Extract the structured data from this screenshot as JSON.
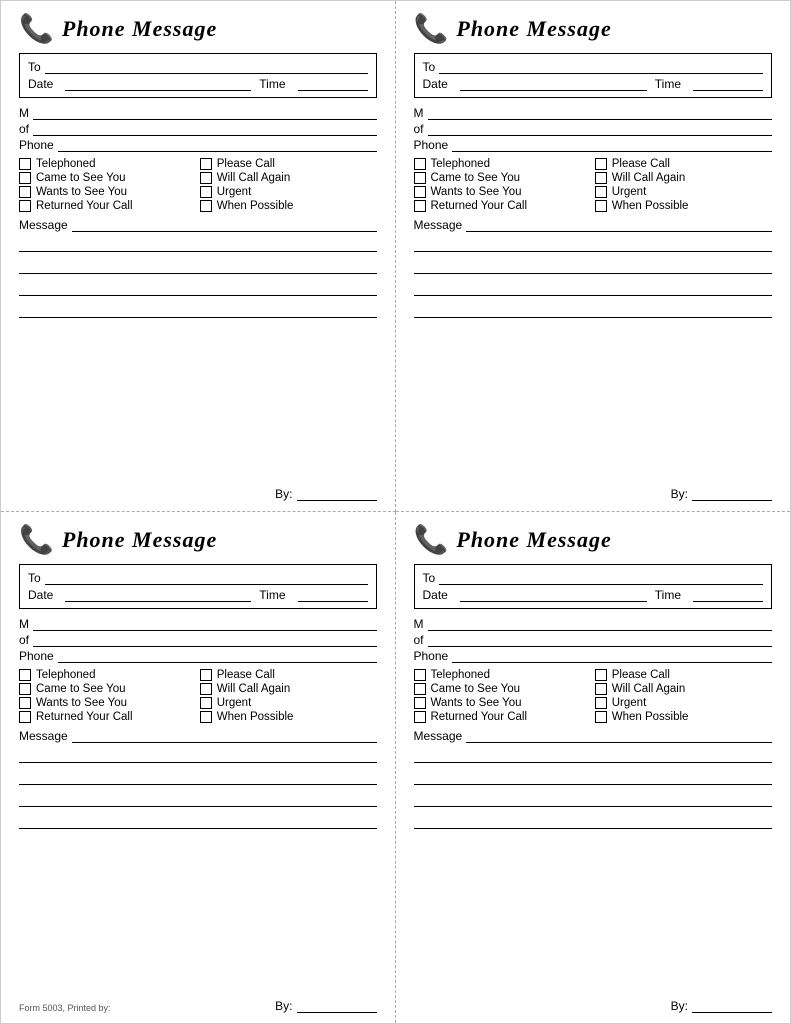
{
  "cards": [
    {
      "id": "card-1",
      "title": "Phone Message",
      "icon": "📞",
      "fields": {
        "to_label": "To",
        "date_label": "Date",
        "time_label": "Time",
        "m_label": "M",
        "of_label": "of",
        "phone_label": "Phone"
      },
      "checkboxes": [
        {
          "label": "Telephoned"
        },
        {
          "label": "Please Call"
        },
        {
          "label": "Came to See You"
        },
        {
          "label": "Will Call Again"
        },
        {
          "label": "Wants to See You"
        },
        {
          "label": "Urgent"
        },
        {
          "label": "Returned Your Call"
        },
        {
          "label": "When Possible"
        }
      ],
      "message_label": "Message",
      "by_label": "By:"
    },
    {
      "id": "card-2",
      "title": "Phone Message",
      "icon": "📞",
      "fields": {
        "to_label": "To",
        "date_label": "Date",
        "time_label": "Time",
        "m_label": "M",
        "of_label": "of",
        "phone_label": "Phone"
      },
      "checkboxes": [
        {
          "label": "Telephoned"
        },
        {
          "label": "Please Call"
        },
        {
          "label": "Came to See You"
        },
        {
          "label": "Will Call Again"
        },
        {
          "label": "Wants to See You"
        },
        {
          "label": "Urgent"
        },
        {
          "label": "Returned Your Call"
        },
        {
          "label": "When Possible"
        }
      ],
      "message_label": "Message",
      "by_label": "By:"
    },
    {
      "id": "card-3",
      "title": "Phone Message",
      "icon": "📞",
      "fields": {
        "to_label": "To",
        "date_label": "Date",
        "time_label": "Time",
        "m_label": "M",
        "of_label": "of",
        "phone_label": "Phone"
      },
      "checkboxes": [
        {
          "label": "Telephoned"
        },
        {
          "label": "Please Call"
        },
        {
          "label": "Came to See You"
        },
        {
          "label": "Will Call Again"
        },
        {
          "label": "Wants to See You"
        },
        {
          "label": "Urgent"
        },
        {
          "label": "Returned Your Call"
        },
        {
          "label": "When Possible"
        }
      ],
      "message_label": "Message",
      "by_label": "By:",
      "footer": "Form 5003, Printed by:"
    },
    {
      "id": "card-4",
      "title": "Phone Message",
      "icon": "📞",
      "fields": {
        "to_label": "To",
        "date_label": "Date",
        "time_label": "Time",
        "m_label": "M",
        "of_label": "of",
        "phone_label": "Phone"
      },
      "checkboxes": [
        {
          "label": "Telephoned"
        },
        {
          "label": "Please Call"
        },
        {
          "label": "Came to See You"
        },
        {
          "label": "Will Call Again"
        },
        {
          "label": "Wants to See You"
        },
        {
          "label": "Urgent"
        },
        {
          "label": "Returned Your Call"
        },
        {
          "label": "When Possible"
        }
      ],
      "message_label": "Message",
      "by_label": "By:"
    }
  ]
}
